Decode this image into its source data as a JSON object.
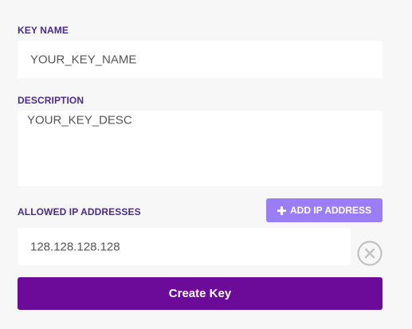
{
  "key_name": {
    "label": "KEY NAME",
    "value": "YOUR_KEY_NAME"
  },
  "description": {
    "label": "DESCRIPTION",
    "value": "YOUR_KEY_DESC"
  },
  "allowed_ips": {
    "label": "ALLOWED IP ADDRESSES",
    "add_button_label": "ADD IP ADDRESS",
    "add_icon": "plus-icon",
    "remove_icon": "close-circle-icon",
    "entries": [
      {
        "value": "128.128.128.128"
      }
    ]
  },
  "submit": {
    "label": "Create Key"
  },
  "colors": {
    "label_text": "#4b2a8c",
    "add_button_bg": "#9b7df5",
    "submit_button_bg": "#6c0b9a",
    "page_bg": "#f7f7f7"
  }
}
